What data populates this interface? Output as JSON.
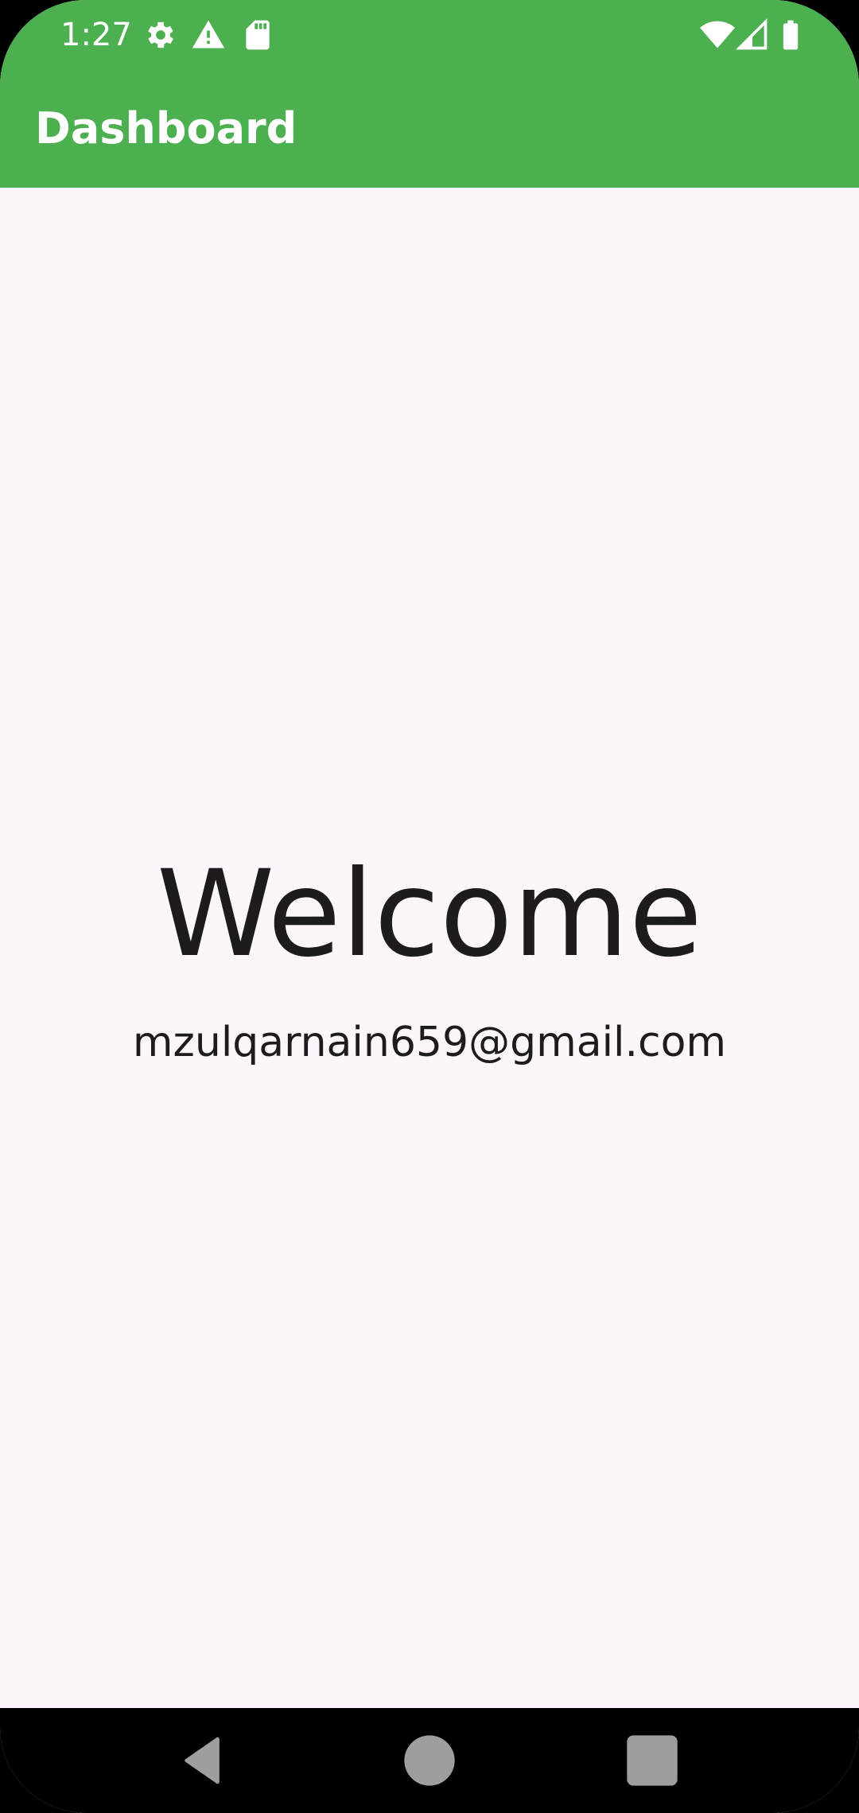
{
  "status_bar": {
    "time": "1:27",
    "icons_left": [
      "gear-icon",
      "warning-icon",
      "sd-card-icon"
    ],
    "icons_right": [
      "wifi-icon",
      "cellular-signal-icon",
      "battery-icon"
    ]
  },
  "app_bar": {
    "title": "Dashboard",
    "color": "#4CAF50"
  },
  "main": {
    "welcome_text": "Welcome",
    "email": "mzulqarnain659@gmail.com",
    "background": "#FCF5FC"
  },
  "nav_bar": {
    "buttons": [
      "back-icon",
      "home-icon",
      "recents-icon"
    ]
  }
}
